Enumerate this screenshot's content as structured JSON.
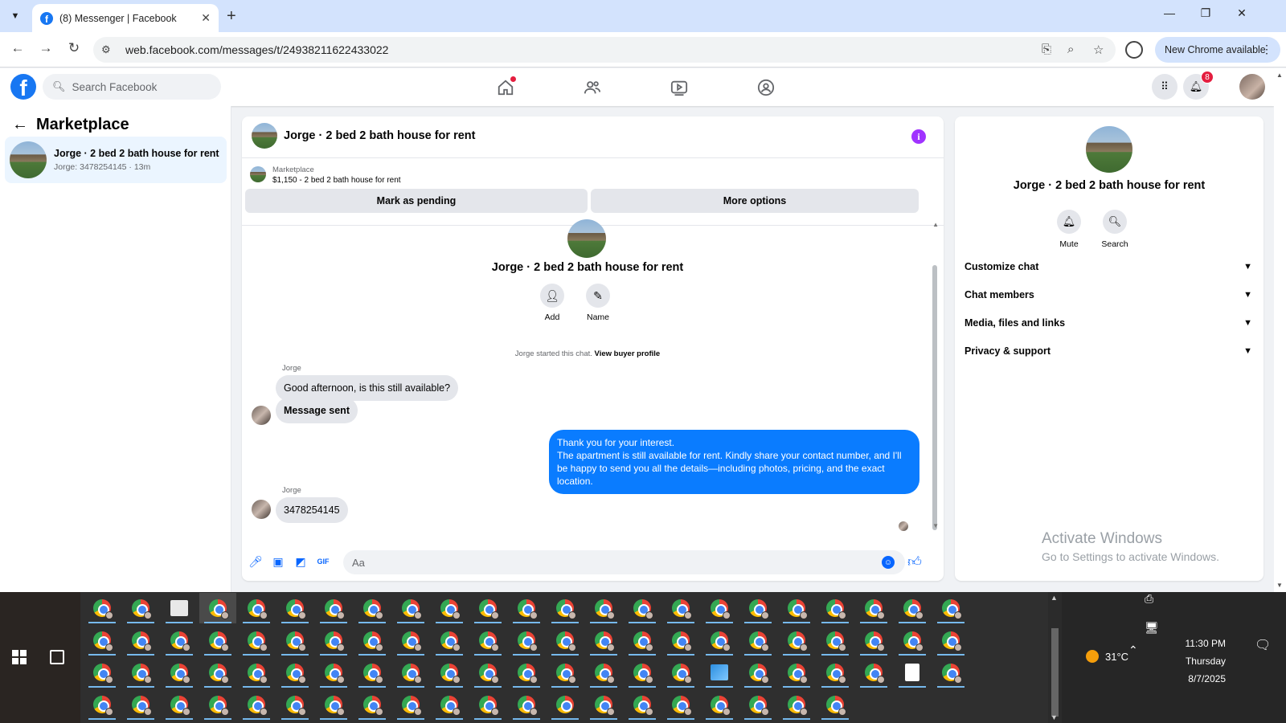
{
  "browser": {
    "tab_title": "(8) Messenger | Facebook",
    "url": "web.facebook.com/messages/t/24938211622433022",
    "new_chrome_label": "New Chrome available"
  },
  "fb_nav": {
    "search_placeholder": "Search Facebook",
    "notification_count": "8"
  },
  "left_panel": {
    "header": "Marketplace",
    "chat_item": {
      "name": "Jorge · 2 bed 2 bath house for rent",
      "preview": "Jorge: 3478254145 · 13m"
    }
  },
  "conversation": {
    "title": "Jorge · 2 bed 2 bath house for rent",
    "marketplace_label": "Marketplace",
    "listing_desc": "$1,150 - 2 bed 2 bath house for rent",
    "mark_pending_label": "Mark as pending",
    "more_options_label": "More options",
    "intro_name": "Jorge · 2 bed 2 bath house for rent",
    "add_label": "Add",
    "name_label": "Name",
    "system_text": "Jorge started this chat.",
    "view_profile_label": "View buyer profile",
    "messages": [
      {
        "sender": "Jorge",
        "text": "Good afternoon, is this still available?"
      },
      {
        "text": "Message sent"
      },
      {
        "text": "Thank you for your interest.\nThe apartment is still available for rent. Kindly share your contact number, and I'll be happy to send you all the details—including photos, pricing, and the exact location."
      },
      {
        "sender": "Jorge",
        "text": "3478254145"
      }
    ],
    "composer_placeholder": "Aa"
  },
  "right_panel": {
    "name": "Jorge · 2 bed 2 bath house for rent",
    "mute_label": "Mute",
    "search_label": "Search",
    "sections": [
      "Customize chat",
      "Chat members",
      "Media, files and links",
      "Privacy & support"
    ]
  },
  "watermark": {
    "line1": "Activate Windows",
    "line2": "Go to Settings to activate Windows."
  },
  "taskbar": {
    "temperature": "31°C",
    "time": "11:30 PM",
    "day": "Thursday",
    "date": "8/7/2025"
  }
}
